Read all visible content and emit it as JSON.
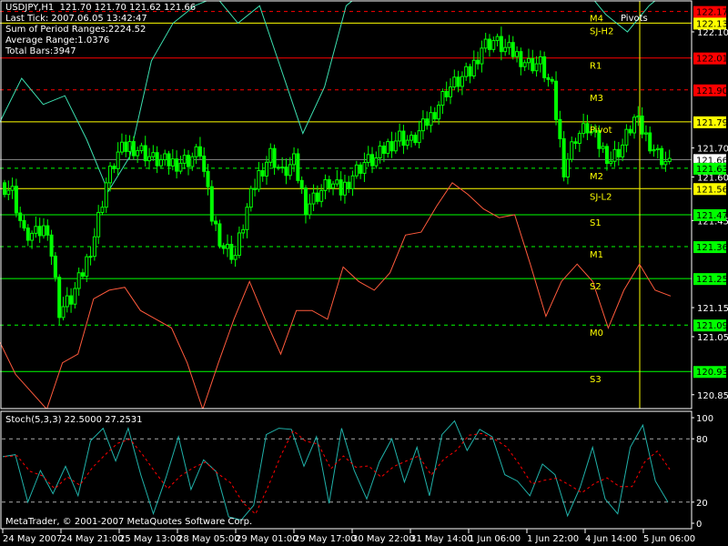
{
  "header": {
    "symbol_line": "USDJPY,H1  121.70 121.70 121.62 121.66",
    "last_tick": "Last Tick: 2007.06.05 13:42:47",
    "sum_ranges": "Sum of Period Ranges:2224.52",
    "avg_range": "Average Range:1.0376",
    "total_bars": "Total Bars:3947"
  },
  "pivots_title": "Pivots",
  "copyright": "MetaTrader, © 2001-2007 MetaQuotes Software Corp.",
  "stoch_label": "Stoch(5,3,3) 22.5000 27.2531",
  "colors": {
    "candle": "#00ff00",
    "upper": "#3ce0b0",
    "lower": "#ff5a3c",
    "stoch_main": "#20b2aa",
    "stoch_signal": "#ff0000",
    "yellow": "#ffff00",
    "red": "#ff0000",
    "green": "#00ff00"
  },
  "chart_data": {
    "type": "candlestick",
    "title": "USDJPY,H1",
    "ylim": [
      120.8,
      122.21
    ],
    "price_ticks": [
      "122.10",
      "121.70",
      "121.60",
      "121.45",
      "121.15",
      "121.05",
      "120.85"
    ],
    "closes": [
      121.58,
      121.55,
      121.4,
      121.4,
      121.43,
      121.14,
      121.18,
      121.27,
      121.4,
      121.58,
      121.68,
      121.71,
      121.69,
      121.66,
      121.65,
      121.65,
      121.66,
      121.69,
      121.46,
      121.36,
      121.33,
      121.49,
      121.61,
      121.68,
      121.61,
      121.65,
      121.5,
      121.54,
      121.58,
      121.55,
      121.61,
      121.65,
      121.66,
      121.71,
      121.74,
      121.72,
      121.77,
      121.83,
      121.9,
      121.93,
      121.96,
      122.05,
      122.07,
      122.04,
      122.02,
      121.99,
      121.99,
      121.9,
      121.63,
      121.74,
      121.77,
      121.71,
      121.66,
      121.71,
      121.8,
      121.74,
      121.68,
      121.64
    ],
    "upper_line": [
      121.79,
      121.94,
      121.85,
      121.88,
      121.73,
      121.55,
      121.67,
      122.0,
      122.13,
      122.19,
      122.22,
      122.13,
      122.19,
      121.97,
      121.75,
      121.91,
      122.19,
      122.25,
      122.25,
      122.25,
      122.25,
      122.25,
      122.25,
      122.25,
      122.25,
      122.25,
      122.25,
      122.25,
      122.16,
      122.1,
      122.19,
      122.25
    ],
    "lower_line": [
      121.03,
      120.92,
      120.86,
      120.8,
      120.96,
      120.99,
      121.18,
      121.21,
      121.22,
      121.14,
      121.11,
      121.08,
      120.96,
      120.8,
      120.96,
      121.11,
      121.24,
      121.11,
      120.99,
      121.14,
      121.14,
      121.11,
      121.29,
      121.24,
      121.21,
      121.27,
      121.4,
      121.41,
      121.5,
      121.58,
      121.54,
      121.49,
      121.46,
      121.47,
      121.3,
      121.12,
      121.24,
      121.3,
      121.24,
      121.08,
      121.21,
      121.3,
      121.21,
      121.19
    ],
    "levels": [
      {
        "name": "M4",
        "price": 122.17,
        "label": "122.17",
        "color": "#ff0000",
        "style": "dashed",
        "text": "#000"
      },
      {
        "name": "SJ-H2",
        "price": 122.13,
        "label": "122.13",
        "color": "#ffff00",
        "style": "solid",
        "text": "#000"
      },
      {
        "name": "R1",
        "price": 122.01,
        "label": "122.01",
        "color": "#ff0000",
        "style": "solid",
        "text": "#000"
      },
      {
        "name": "M3",
        "price": 121.9,
        "label": "121.90",
        "color": "#ff0000",
        "style": "dashed",
        "text": "#000"
      },
      {
        "name": "Pivot",
        "price": 121.79,
        "label": "121.79",
        "color": "#ffff00",
        "style": "solid",
        "text": "#000"
      },
      {
        "name": "",
        "price": 121.66,
        "label": "121.66",
        "color": "#ffffff",
        "line": "#8a8a8a",
        "style": "solid",
        "text": "#000"
      },
      {
        "name": "M2",
        "price": 121.63,
        "label": "121.63",
        "color": "#00ff00",
        "style": "dashed",
        "text": "#000"
      },
      {
        "name": "SJ-L2",
        "price": 121.56,
        "label": "121.56",
        "color": "#ffff00",
        "style": "solid",
        "text": "#000"
      },
      {
        "name": "S1",
        "price": 121.47,
        "label": "121.47",
        "color": "#00ff00",
        "style": "solid",
        "text": "#000"
      },
      {
        "name": "M1",
        "price": 121.36,
        "label": "121.36",
        "color": "#00ff00",
        "style": "dashed",
        "text": "#000"
      },
      {
        "name": "S2",
        "price": 121.25,
        "label": "121.25",
        "color": "#00ff00",
        "style": "solid",
        "text": "#000"
      },
      {
        "name": "M0",
        "price": 121.09,
        "label": "121.09",
        "color": "#00ff00",
        "style": "dashed",
        "text": "#000"
      },
      {
        "name": "S3",
        "price": 120.93,
        "label": "120.93",
        "color": "#00ff00",
        "style": "solid",
        "text": "#000"
      }
    ],
    "x_labels": [
      "24 May 2007",
      "24 May 21:00",
      "25 May 13:00",
      "28 May 05:00",
      "29 May 01:00",
      "29 May 17:00",
      "30 May 22:00",
      "31 May 14:00",
      "1 Jun 06:00",
      "1 Jun 22:00",
      "4 Jun 14:00",
      "5 Jun 06:00"
    ],
    "stochastic": {
      "params": "5,3,3",
      "ylim": [
        0,
        100
      ],
      "levels": [
        20,
        80
      ],
      "ticks": [
        "100",
        "80",
        "20",
        "0"
      ],
      "main": [
        63,
        65,
        20,
        50,
        28,
        54,
        26,
        78,
        90,
        59,
        90,
        46,
        9,
        43,
        82,
        32,
        60,
        49,
        6,
        3,
        17,
        84,
        90,
        89,
        54,
        82,
        19,
        90,
        50,
        23,
        58,
        80,
        39,
        72,
        26,
        84,
        97,
        69,
        89,
        82,
        46,
        40,
        26,
        56,
        46,
        7,
        34,
        72,
        23,
        9,
        72,
        93,
        40,
        20
      ]
    }
  }
}
